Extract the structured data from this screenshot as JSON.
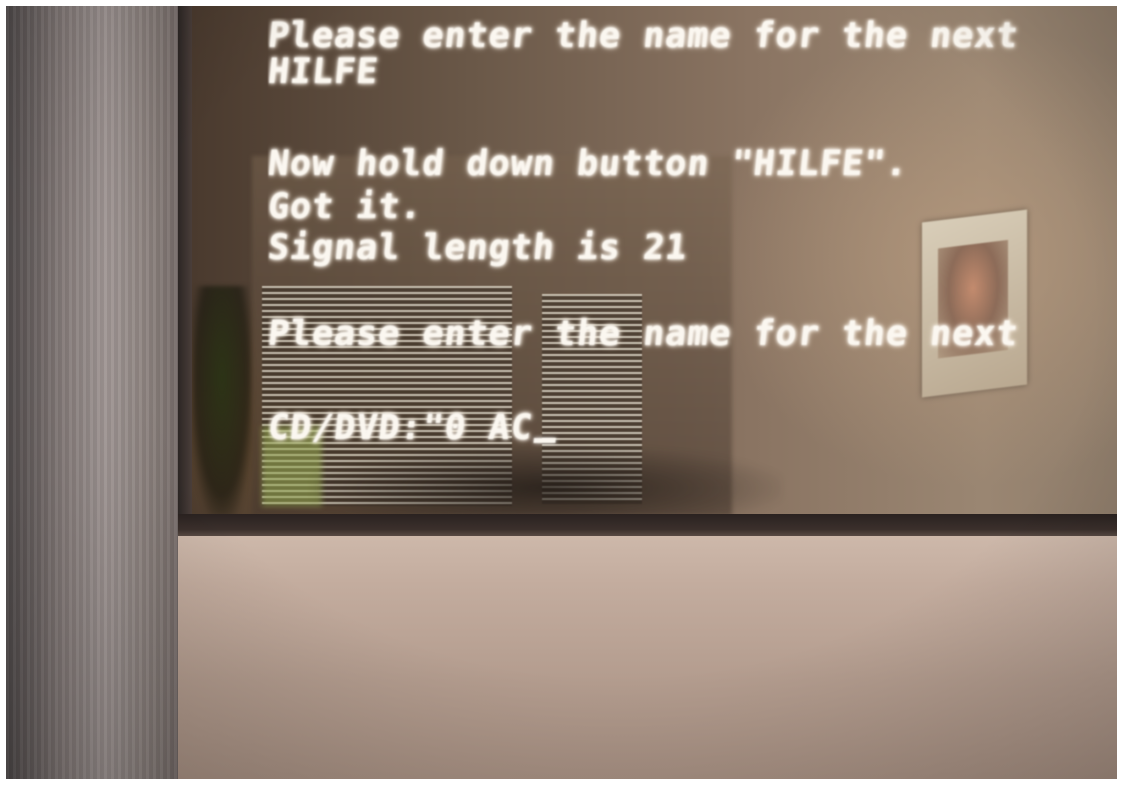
{
  "photo": {
    "subject": "photo-of-crt-monitor",
    "colors": {
      "text": "#fbf7f0",
      "screen_reflection": "#8a7462",
      "bezel": "#c3ac9e",
      "wall": "#8a807e"
    }
  },
  "terminal": {
    "lines": [
      "Please enter the name for the next",
      "HILFE",
      "Now hold down button \"HILFE\".",
      "Got it.",
      "Signal length is 21",
      "Please enter the name for the next",
      "CD/DVD:\"0 AC"
    ],
    "cursor": "_"
  }
}
